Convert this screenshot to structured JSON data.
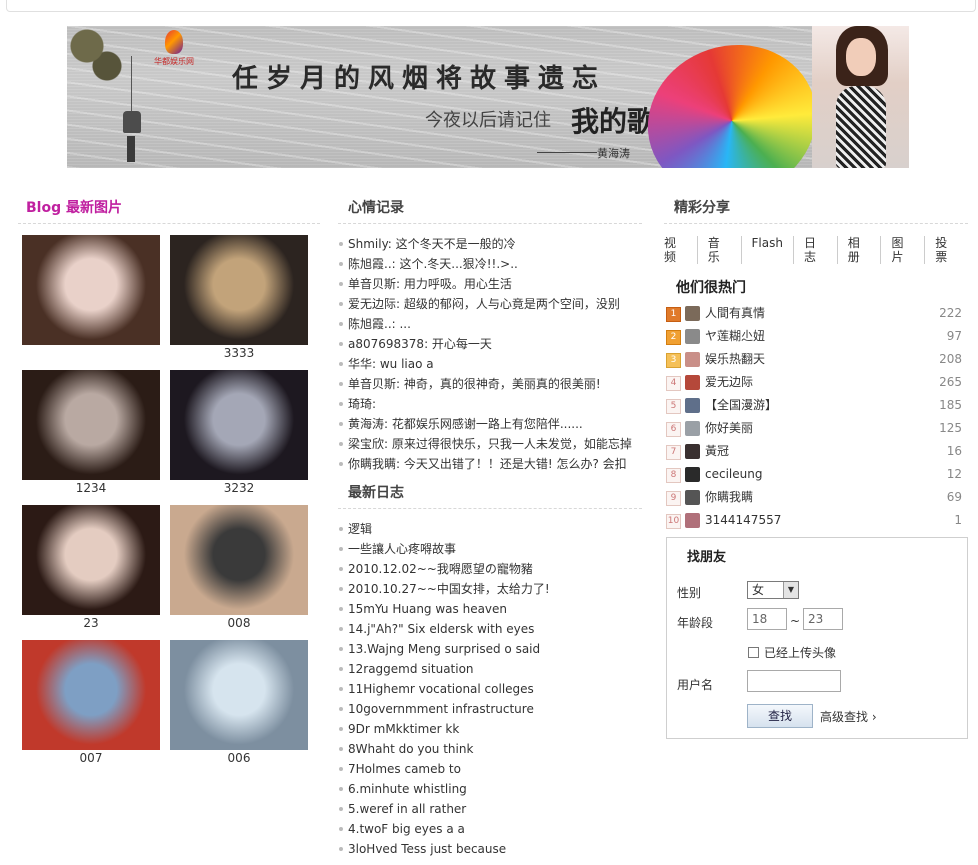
{
  "banner": {
    "logo_text": "华都娱乐网",
    "slogan_main": "任岁月的风烟将故事遗忘",
    "slogan_sub_prefix": "今夜以后请记住",
    "slogan_sub_emph": "我的歌",
    "signature": "黄海涛"
  },
  "photos": {
    "title": "Blog 最新图片",
    "items": [
      {
        "caption": "",
        "c1": "#e9d1c9",
        "c2": "#4a3025"
      },
      {
        "caption": "3333",
        "c1": "#c2a37a",
        "c2": "#2c2420"
      },
      {
        "caption": "1234",
        "c1": "#b9a9a2",
        "c2": "#2b1c16"
      },
      {
        "caption": "3232",
        "c1": "#a4a7b6",
        "c2": "#1d1820"
      },
      {
        "caption": "23",
        "c1": "#e4ccc1",
        "c2": "#2c1a15"
      },
      {
        "caption": "008",
        "c1": "#3a3a3a",
        "c2": "#c9a98f"
      },
      {
        "caption": "007",
        "c1": "#7e9fc4",
        "c2": "#c0392b"
      },
      {
        "caption": "006",
        "c1": "#d6e4ee",
        "c2": "#7d8fa0"
      }
    ]
  },
  "mood": {
    "title": "心情记录",
    "items": [
      "Shmily: 这个冬天不是一般的冷",
      "陈旭霞..: 这个.冬天...狠冷!!.>..",
      "单音贝斯: 用力呼吸。用心生活",
      "爱无边际: 超级的郁闷，人与心竟是两个空间，没别",
      "陈旭霞..: ...",
      "a807698378: 开心每一天",
      "华华: wu  liao   a",
      "单音贝斯: 神奇，真的很神奇，美丽真的很美丽!",
      "琦琦:",
      "黄海涛: 花都娱乐网感谢一路上有您陪伴......",
      "梁宝欣: 原来过得很快乐，只我一人未发觉，如能忘掉",
      "你瞒我瞒: 今天又出错了！！还是大错! 怎么办? 会扣"
    ]
  },
  "blog": {
    "title": "最新日志",
    "items": [
      "逻辑",
      "一些讓人心疼嘚故事",
      "2010.12.02~~我嘚愿望の寵物豬",
      "2010.10.27~~中国女排，太给力了!",
      "15mYu Huang was heaven",
      "14.j\"Ah?\" Six eldersk with eyes",
      "13.Wajng Meng surprised o said",
      "12raggemd situation",
      "11Highemr vocational colleges",
      "10governmment infrastructure",
      "9Dr mMkktimer kk",
      "8Whaht do you think",
      "7Holmes cameb to",
      "6.minhute whistling",
      "5.weref in all rather",
      "4.twoF big eyes a a",
      "3loHved Tess just because"
    ]
  },
  "share": {
    "title": "精彩分享",
    "links": [
      "视频",
      "音乐",
      "Flash",
      "日志",
      "相册",
      "图片",
      "投票"
    ]
  },
  "hot": {
    "title": "他们很热门",
    "items": [
      {
        "rank": "1",
        "name": "人間有真情",
        "count": "222",
        "av": "#7b6a5a"
      },
      {
        "rank": "2",
        "name": "ヤ莲糊尐妞",
        "count": "97",
        "av": "#8a8a8a"
      },
      {
        "rank": "3",
        "name": "娱乐热翻天",
        "count": "208",
        "av": "#c98f88"
      },
      {
        "rank": "4",
        "name": "爱无边际",
        "count": "265",
        "av": "#b5483a"
      },
      {
        "rank": "5",
        "name": "【全国漫游】",
        "count": "185",
        "av": "#5f6f8a"
      },
      {
        "rank": "6",
        "name": "你好美丽",
        "count": "125",
        "av": "#9aa0a6"
      },
      {
        "rank": "7",
        "name": "黃冠",
        "count": "16",
        "av": "#3a3030"
      },
      {
        "rank": "8",
        "name": "cecileung",
        "count": "12",
        "av": "#2a2a2a"
      },
      {
        "rank": "9",
        "name": "你瞒我瞒",
        "count": "69",
        "av": "#555"
      },
      {
        "rank": "10",
        "name": "3144147557",
        "count": "1",
        "av": "#b0707a"
      }
    ]
  },
  "find": {
    "title": "找朋友",
    "gender_label": "性别",
    "gender_value": "女",
    "age_label": "年龄段",
    "age_from": "18",
    "age_sep": "~",
    "age_to": "23",
    "avatar_label": "已经上传头像",
    "username_label": "用户名",
    "search_label": "查找",
    "advanced_label": "高级查找 ›"
  }
}
